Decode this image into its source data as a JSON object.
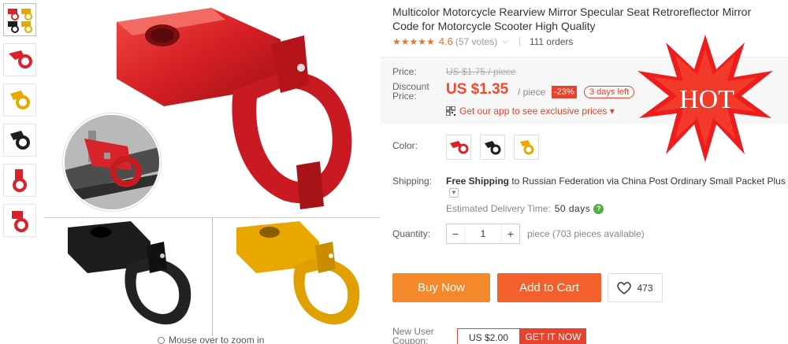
{
  "product": {
    "title": "Multicolor Motorcycle Rearview Mirror Specular Seat Retroreflector Mirror Code for Motorcycle Scooter High Quality",
    "rating": "4.6",
    "votes": "(57 votes)",
    "orders": "111 orders",
    "stars": "★★★★★"
  },
  "price": {
    "price_label": "Price:",
    "old_price": "US $1.75 / piece",
    "discount_label": "Discount Price:",
    "current_price": "US $1.35",
    "per_unit": "/ piece",
    "discount_badge": "-23%",
    "days_left": "3 days left",
    "app_link": "Get our app to see exclusive prices ▾"
  },
  "color": {
    "label": "Color:",
    "options": [
      "red",
      "black",
      "gold"
    ],
    "colors": {
      "red": "#d8232a",
      "black": "#1e1e1e",
      "gold": "#e8a800"
    }
  },
  "shipping": {
    "label": "Shipping:",
    "free": "Free Shipping",
    "to_word": " to ",
    "destination": "Russian Federation via China Post Ordinary Small Packet Plus",
    "est_label": "Estimated Delivery Time:",
    "est_days": "50 days",
    "help": "?"
  },
  "quantity": {
    "label": "Quantity:",
    "minus": "−",
    "value": "1",
    "plus": "+",
    "note": "piece (703 pieces available)"
  },
  "actions": {
    "buy_now": "Buy Now",
    "add_to_cart": "Add to Cart",
    "wishlist_count": "473"
  },
  "coupon": {
    "label": "New User Coupon:",
    "value": "US $2.00",
    "get": "GET IT NOW"
  },
  "gallery": {
    "zoom_hint": "Mouse over to zoom in"
  },
  "badge": {
    "hot": "HOT"
  },
  "theme": {
    "accent": "#e5432d",
    "buy_orange": "#f6882c",
    "cart_orange": "#f4602b"
  }
}
